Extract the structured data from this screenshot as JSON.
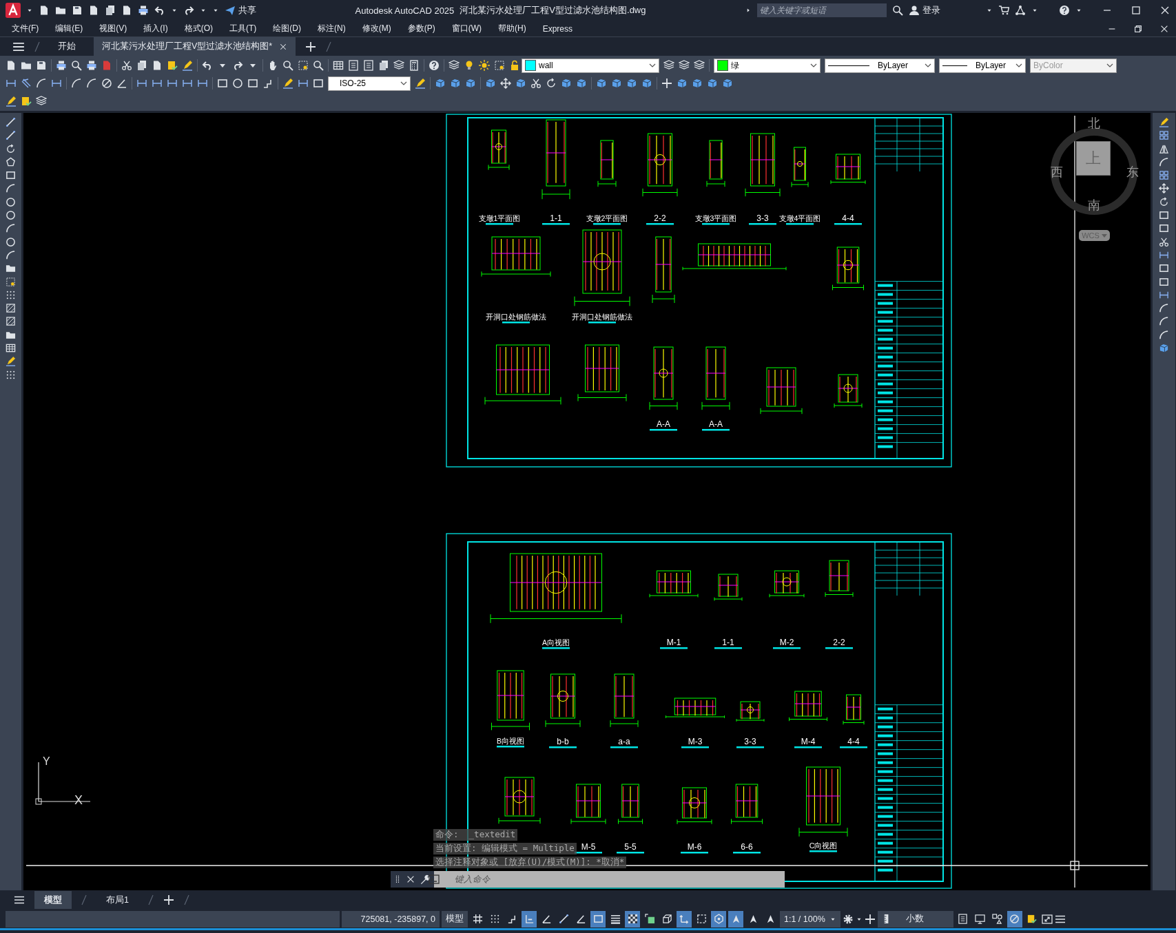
{
  "title_bar": {
    "app_title": "Autodesk AutoCAD 2025",
    "file_title": "河北某污水处理厂工程V型过滤水池结构图.dwg",
    "share": "共享",
    "search": {
      "placeholder": "键入关键字或短语"
    },
    "sign_in": "登录"
  },
  "menu_bar": [
    "文件(F)",
    "编辑(E)",
    "视图(V)",
    "插入(I)",
    "格式(O)",
    "工具(T)",
    "绘图(D)",
    "标注(N)",
    "修改(M)",
    "参数(P)",
    "窗口(W)",
    "帮助(H)",
    "Express"
  ],
  "doc_tabs": [
    {
      "label": "开始",
      "selected": false
    },
    {
      "label": "河北某污水处理厂工程V型过滤水池结构图*",
      "selected": true
    }
  ],
  "properties_toolbar": {
    "layer": "wall",
    "color_name": "绿",
    "color": "#00ff00",
    "linetype": "ByLayer",
    "lineweight": "ByLayer",
    "plot_style": "ByColor",
    "plot_style_disabled": true
  },
  "dim_style": "ISO-25",
  "drawing": {
    "sheets": [
      {
        "labels": [
          "支墩1平面图",
          "1-1",
          "支墩2平面图",
          "2-2",
          "支墩3平面图",
          "3-3",
          "支墩4平面图",
          "4-4",
          "开洞口处钢筋做法",
          "开洞口处钢筋做法",
          "A-A",
          "A-A"
        ]
      },
      {
        "labels": [
          "A向视图",
          "M-1",
          "1-1",
          "M-2",
          "2-2",
          "B向视图",
          "b-b",
          "a-a",
          "M-3",
          "3-3",
          "M-4",
          "4-4",
          "M-5",
          "5-5",
          "M-6",
          "6-6",
          "C向视图"
        ]
      }
    ],
    "ucs_y": "Y",
    "ucs_x": "X"
  },
  "viewcube": {
    "north": "北",
    "west": "西",
    "east": "东",
    "south": "南",
    "top": "上",
    "ucs": "WCS"
  },
  "command_line": {
    "history": [
      "命令:  _textedit",
      "当前设置: 编辑模式 = Multiple",
      "选择注释对象或 [放弃(U)/模式(M)]: *取消*"
    ],
    "placeholder": "键入命令"
  },
  "layout_tabs": [
    {
      "label": "模型",
      "selected": true
    },
    {
      "label": "布局1",
      "selected": false
    }
  ],
  "status_bar": {
    "coordinates": "725081, -235897, 0",
    "space": "模型",
    "toggles_left": [
      {
        "kind": "grid",
        "on": false
      },
      {
        "kind": "snap",
        "on": false
      },
      {
        "kind": "infer",
        "on": false
      },
      {
        "kind": "ortho",
        "on": true
      },
      {
        "kind": "polar",
        "on": false
      },
      {
        "kind": "osnap",
        "on": false
      },
      {
        "kind": "angle",
        "on": false
      },
      {
        "kind": "select",
        "on": true
      },
      {
        "kind": "lineweight",
        "on": false
      },
      {
        "kind": "transparency",
        "on": true
      },
      {
        "kind": "cycle",
        "on": false
      },
      {
        "kind": "osnap3d",
        "on": false
      },
      {
        "kind": "ducs",
        "on": true
      },
      {
        "kind": "dyn",
        "on": false
      },
      {
        "kind": "gizmo",
        "on": true
      },
      {
        "kind": "annovis",
        "on": true
      },
      {
        "kind": "autoscale",
        "on": false
      },
      {
        "kind": "annoscale",
        "on": false
      }
    ],
    "annotation_scale": "1:1 / 100%",
    "units": "小数",
    "toggles_right": [
      {
        "kind": "quickprops",
        "on": false
      },
      {
        "kind": "lockui",
        "on": false
      },
      {
        "kind": "isolate",
        "on": false
      },
      {
        "kind": "hardware",
        "on": true
      },
      {
        "kind": "cleanscreen",
        "on": false
      }
    ]
  }
}
